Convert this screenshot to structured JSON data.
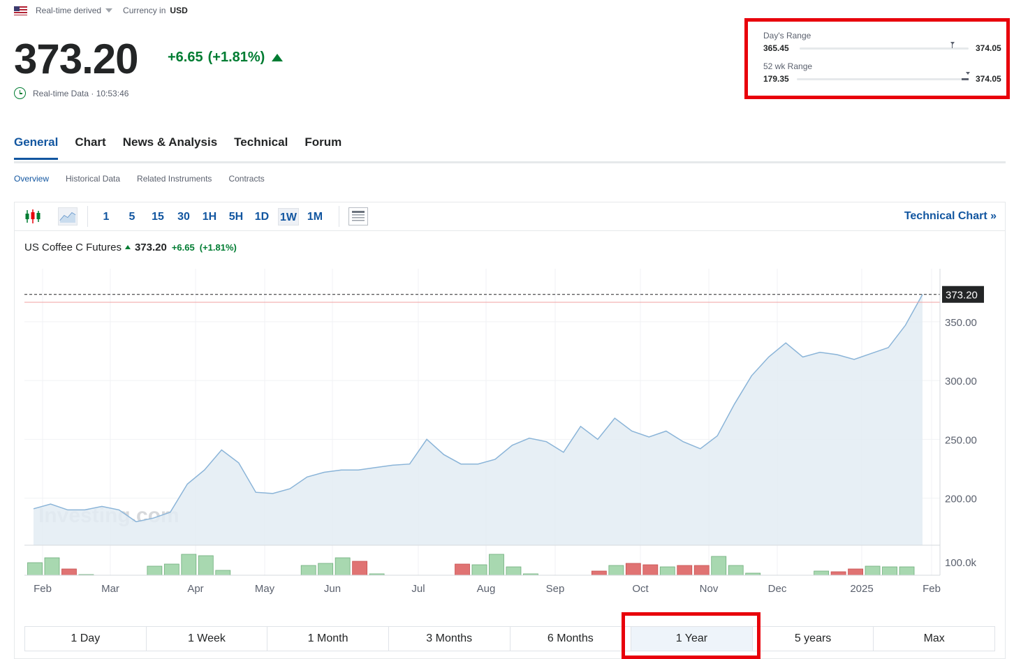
{
  "header": {
    "feed_label": "Real-time derived",
    "currency_label": "Currency in",
    "currency": "USD",
    "price": "373.20",
    "change": "+6.65",
    "change_pct": "(+1.81%)",
    "realtime_label": "Real-time Data",
    "time": "10:53:46",
    "flag": "us-flag-icon"
  },
  "ranges": {
    "day": {
      "title": "Day's Range",
      "low": "365.45",
      "high": "374.05"
    },
    "week52": {
      "title": "52 wk Range",
      "low": "179.35",
      "high": "374.05"
    }
  },
  "tabs": [
    {
      "label": "General",
      "active": true
    },
    {
      "label": "Chart"
    },
    {
      "label": "News & Analysis"
    },
    {
      "label": "Technical"
    },
    {
      "label": "Forum"
    }
  ],
  "subtabs": [
    {
      "label": "Overview",
      "active": true
    },
    {
      "label": "Historical Data"
    },
    {
      "label": "Related Instruments"
    },
    {
      "label": "Contracts"
    }
  ],
  "toolbar": {
    "intervals": [
      "1",
      "5",
      "15",
      "30",
      "1H",
      "5H",
      "1D",
      "1W",
      "1M"
    ],
    "selected_interval": "1W",
    "technical_chart": "Technical Chart »"
  },
  "chart_legend": {
    "name": "US Coffee C Futures",
    "price": "373.20",
    "change": "+6.65",
    "change_pct": "(+1.81%)"
  },
  "periods": [
    "1 Day",
    "1 Week",
    "1 Month",
    "3 Months",
    "6 Months",
    "1 Year",
    "5 years",
    "Max"
  ],
  "selected_period": "1 Year",
  "watermark": "Investing.com",
  "colors": {
    "up": "#007c32",
    "down": "#e8000b",
    "accent": "#1256a0",
    "line": "#8ab4d8",
    "area": "#e3ecf3",
    "vol_up": "#a8d8b0",
    "vol_down": "#e07373"
  },
  "chart_data": {
    "type": "area",
    "x_ticks": [
      "Feb",
      "Mar",
      "Apr",
      "May",
      "Jun",
      "Jul",
      "Aug",
      "Sep",
      "Oct",
      "Nov",
      "Dec",
      "2025",
      "Feb"
    ],
    "y_ticks": [
      "350.00",
      "300.00",
      "250.00",
      "200.00"
    ],
    "ylim": [
      160,
      395
    ],
    "last_price_label": "373.20",
    "volume_label": "100.0k",
    "series": [
      {
        "values": [
          191,
          195,
          190,
          190,
          193,
          190,
          180,
          183,
          188,
          212,
          224,
          241,
          230,
          205,
          204,
          208,
          218,
          222,
          224,
          224,
          226,
          228,
          229,
          250,
          237,
          229,
          229,
          233,
          245,
          251,
          248,
          239,
          261,
          250,
          268,
          257,
          252,
          257,
          248,
          242,
          253,
          280,
          304,
          320,
          332,
          320,
          324,
          322,
          318,
          323,
          328,
          347,
          373.2
        ]
      }
    ],
    "volume": [
      {
        "v": 1.8,
        "d": "up"
      },
      {
        "v": 2.5,
        "d": "up"
      },
      {
        "v": 0.9,
        "d": "down"
      },
      {
        "v": 0.1,
        "d": "up"
      },
      {
        "v": 0,
        "d": "up"
      },
      {
        "v": 0,
        "d": "up"
      },
      {
        "v": 0,
        "d": "up"
      },
      {
        "v": 1.3,
        "d": "up"
      },
      {
        "v": 1.6,
        "d": "up"
      },
      {
        "v": 3.0,
        "d": "up"
      },
      {
        "v": 2.8,
        "d": "up"
      },
      {
        "v": 0.7,
        "d": "up"
      },
      {
        "v": 0,
        "d": "up"
      },
      {
        "v": 0,
        "d": "up"
      },
      {
        "v": 0,
        "d": "up"
      },
      {
        "v": 0,
        "d": "up"
      },
      {
        "v": 1.4,
        "d": "up"
      },
      {
        "v": 1.7,
        "d": "up"
      },
      {
        "v": 2.5,
        "d": "up"
      },
      {
        "v": 2.0,
        "d": "down"
      },
      {
        "v": 0.2,
        "d": "up"
      },
      {
        "v": 0,
        "d": "up"
      },
      {
        "v": 0,
        "d": "up"
      },
      {
        "v": 0,
        "d": "up"
      },
      {
        "v": 0,
        "d": "up"
      },
      {
        "v": 1.6,
        "d": "down"
      },
      {
        "v": 1.5,
        "d": "up"
      },
      {
        "v": 3.0,
        "d": "up"
      },
      {
        "v": 1.2,
        "d": "up"
      },
      {
        "v": 0.2,
        "d": "up"
      },
      {
        "v": 0,
        "d": "up"
      },
      {
        "v": 0,
        "d": "up"
      },
      {
        "v": 0,
        "d": "up"
      },
      {
        "v": 0.6,
        "d": "down"
      },
      {
        "v": 1.4,
        "d": "up"
      },
      {
        "v": 1.7,
        "d": "down"
      },
      {
        "v": 1.5,
        "d": "down"
      },
      {
        "v": 1.2,
        "d": "up"
      },
      {
        "v": 1.4,
        "d": "down"
      },
      {
        "v": 1.4,
        "d": "down"
      },
      {
        "v": 2.7,
        "d": "up"
      },
      {
        "v": 1.4,
        "d": "up"
      },
      {
        "v": 0.3,
        "d": "up"
      },
      {
        "v": 0,
        "d": "up"
      },
      {
        "v": 0,
        "d": "up"
      },
      {
        "v": 0,
        "d": "up"
      },
      {
        "v": 0.6,
        "d": "up"
      },
      {
        "v": 0.5,
        "d": "down"
      },
      {
        "v": 0.9,
        "d": "down"
      },
      {
        "v": 1.3,
        "d": "up"
      },
      {
        "v": 1.2,
        "d": "up"
      },
      {
        "v": 1.2,
        "d": "up"
      },
      {
        "v": 0,
        "d": "up"
      }
    ],
    "volume_unit_max": 4
  }
}
